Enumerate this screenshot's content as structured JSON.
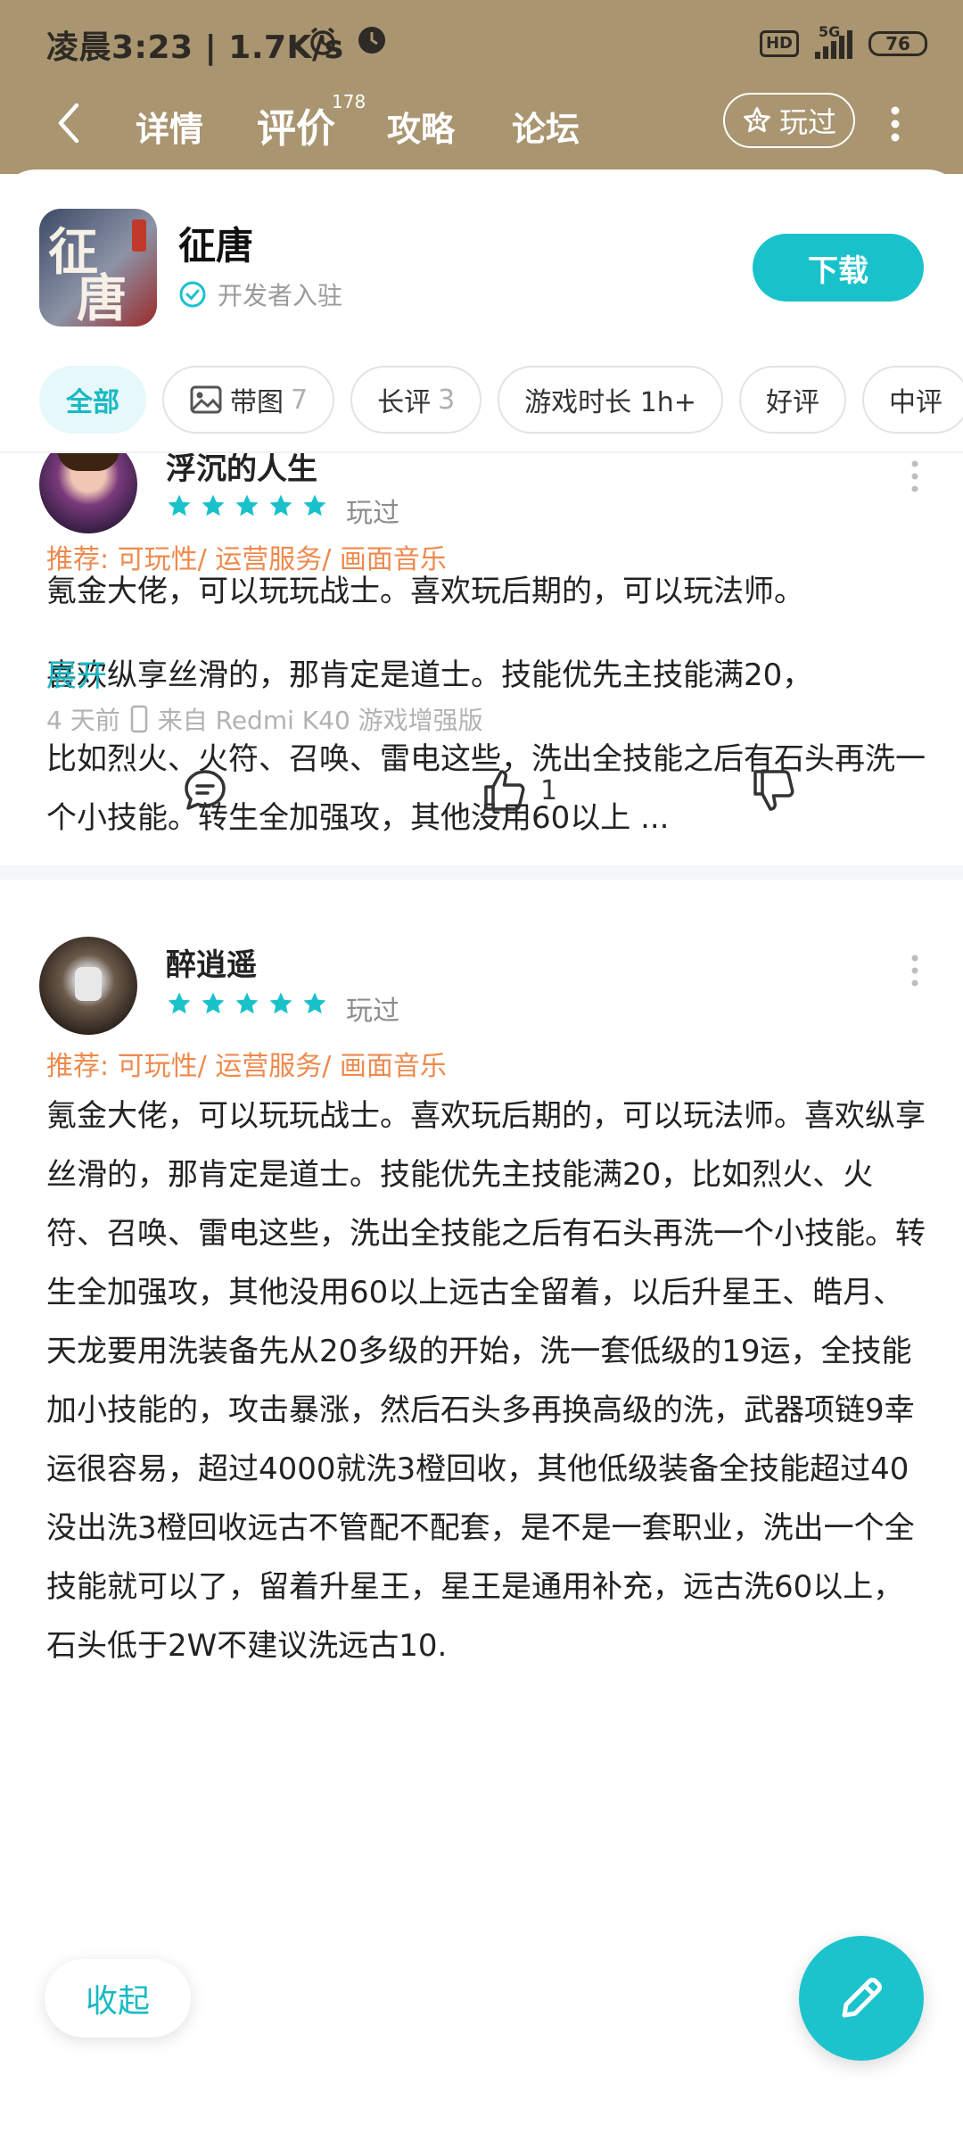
{
  "status_bar": {
    "time": "凌晨3:23",
    "speed": "1.7K/s",
    "network": "5G",
    "battery": "76"
  },
  "nav": {
    "tabs": [
      {
        "label": "详情"
      },
      {
        "label": "评价",
        "badge": "178"
      },
      {
        "label": "攻略"
      },
      {
        "label": "论坛"
      }
    ],
    "played_label": "玩过"
  },
  "game": {
    "name": "征唐",
    "dev_label": "开发者入驻",
    "download_label": "下载"
  },
  "filters": [
    {
      "label": "全部"
    },
    {
      "label": "带图",
      "count": "7"
    },
    {
      "label": "长评",
      "count": "3"
    },
    {
      "label": "游戏时长 1h+"
    },
    {
      "label": "好评"
    },
    {
      "label": "中评"
    }
  ],
  "reviews": [
    {
      "user": "浮沉的人生",
      "rating": 5,
      "status": "玩过",
      "tags": "推荐: 可玩性/ 运营服务/ 画面音乐",
      "paragraphs": [
        "氪金大佬，可以玩玩战士。喜欢玩后期的，可以玩法师。",
        "喜欢纵享丝滑的，那肯定是道士。技能优先主技能满20，",
        "比如烈火、火符、召唤、雷电这些，洗出全技能之后有石头再洗一个小技能。转生全加强攻，其他没用60以上 ..."
      ],
      "expand_label": "展开",
      "time": "4 天前",
      "device": "来自 Redmi K40 游戏增强版",
      "likes": "1"
    },
    {
      "user": "醉逍遥",
      "rating": 5,
      "status": "玩过",
      "tags": "推荐: 可玩性/ 运营服务/ 画面音乐",
      "text": "氪金大佬，可以玩玩战士。喜欢玩后期的，可以玩法师。喜欢纵享丝滑的，那肯定是道士。技能优先主技能满20，比如烈火、火符、召唤、雷电这些，洗出全技能之后有石头再洗一个小技能。转生全加强攻，其他没用60以上远古全留着，以后升星王、皓月、天龙要用洗装备先从20多级的开始，洗一套低级的19运，全技能加小技能的，攻击暴涨，然后石头多再换高级的洗，武器项链9幸运很容易，超过4000就洗3橙回收，其他低级装备全技能超过40没出洗3橙回收远古不管配不配套，是不是一套职业，洗出一个全技能就可以了，留着升星王，星王是通用补充，远古洗60以上，石头低于2W不建议洗远古10."
    }
  ],
  "floating": {
    "collapse_label": "收起"
  },
  "colors": {
    "header": "#a99570",
    "accent": "#19c2cb",
    "tag_orange": "#ee8a4d"
  }
}
